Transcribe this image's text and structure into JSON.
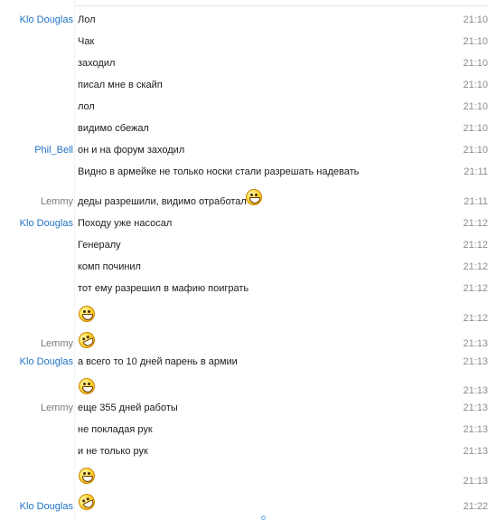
{
  "chat": {
    "rows": [
      {
        "sender": "Klo Douglas",
        "text": "Лол",
        "time": "21:10"
      },
      {
        "sender": "",
        "text": "Чак",
        "time": "21:10"
      },
      {
        "sender": "",
        "text": "заходил",
        "time": "21:10"
      },
      {
        "sender": "",
        "text": "писал мне в скайп",
        "time": "21:10"
      },
      {
        "sender": "",
        "text": "лол",
        "time": "21:10"
      },
      {
        "sender": "",
        "text": "видимо сбежал",
        "time": "21:10"
      },
      {
        "sender": "Phil_Bell",
        "text": "он и на форум заходил",
        "time": "21:10"
      },
      {
        "sender": "",
        "text": "Видно в армейке не только носки стали разрешать надевать",
        "time": "21:11"
      },
      {
        "sender": "Lemmy",
        "text": "деды разрешили, видимо отработал",
        "time": "21:11",
        "emoticon": "laugh"
      },
      {
        "sender": "Klo Douglas",
        "text": "Походу уже насосал",
        "time": "21:12"
      },
      {
        "sender": "",
        "text": "Генералу",
        "time": "21:12"
      },
      {
        "sender": "",
        "text": "комп починил",
        "time": "21:12"
      },
      {
        "sender": "",
        "text": "тот ему разрешил в мафию поиграть",
        "time": "21:12"
      },
      {
        "sender": "",
        "text": "",
        "time": "21:12",
        "emoticon": "laugh"
      },
      {
        "sender": "Lemmy",
        "text": "",
        "time": "21:13",
        "emoticon": "rofl"
      },
      {
        "sender": "Klo Douglas",
        "text": "а всего то 10 дней парень в армии",
        "time": "21:13"
      },
      {
        "sender": "",
        "text": "",
        "time": "21:13",
        "emoticon": "laugh"
      },
      {
        "sender": "Lemmy",
        "text": "еще 355 дней работы",
        "time": "21:13"
      },
      {
        "sender": "",
        "text": "не покладая рук",
        "time": "21:13"
      },
      {
        "sender": "",
        "text": "и не только рук",
        "time": "21:13"
      },
      {
        "sender": "",
        "text": "",
        "time": "21:13",
        "emoticon": "laugh"
      },
      {
        "sender": "Klo Douglas",
        "text": "",
        "time": "21:22",
        "emoticon": "rofl"
      }
    ]
  },
  "colors": {
    "sender_blue": "#1f73c4",
    "sender_gray": "#7a7a7a",
    "time": "#8c8c8c"
  }
}
